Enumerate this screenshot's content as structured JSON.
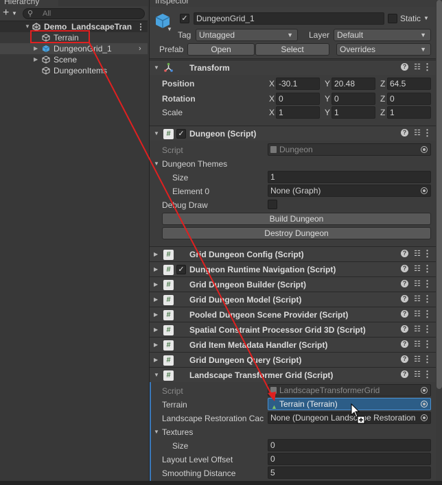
{
  "hierarchy": {
    "tab_label": "Hierarchy",
    "search_placeholder": "All",
    "scene_name": "Demo_LandscapeTran",
    "items": [
      {
        "label": "Terrain"
      },
      {
        "label": "DungeonGrid_1"
      },
      {
        "label": "Scene"
      },
      {
        "label": "DungeonItems"
      }
    ]
  },
  "inspector": {
    "tab_label": "Inspector",
    "object_name": "DungeonGrid_1",
    "static_label": "Static",
    "tag_label": "Tag",
    "tag_value": "Untagged",
    "layer_label": "Layer",
    "layer_value": "Default",
    "prefab_label": "Prefab",
    "prefab_open": "Open",
    "prefab_select": "Select",
    "prefab_overrides": "Overrides",
    "transform": {
      "title": "Transform",
      "position_label": "Position",
      "rotation_label": "Rotation",
      "scale_label": "Scale",
      "axis_x": "X",
      "axis_y": "Y",
      "axis_z": "Z",
      "position": {
        "x": "-30.1",
        "y": "20.48",
        "z": "64.5"
      },
      "rotation": {
        "x": "0",
        "y": "0",
        "z": "0"
      },
      "scale": {
        "x": "1",
        "y": "1",
        "z": "1"
      }
    },
    "dungeon_script": {
      "title": "Dungeon (Script)",
      "script_label": "Script",
      "script_value": "Dungeon",
      "themes_label": "Dungeon Themes",
      "size_label": "Size",
      "size_value": "1",
      "element_label": "Element 0",
      "element_value": "None (Graph)",
      "debug_label": "Debug Draw",
      "build_button": "Build Dungeon",
      "destroy_button": "Destroy Dungeon"
    },
    "components": [
      {
        "title": "Grid Dungeon Config (Script)"
      },
      {
        "title": "Dungeon Runtime Navigation (Script)"
      },
      {
        "title": "Grid Dungeon Builder (Script)"
      },
      {
        "title": "Grid Dungeon Model (Script)"
      },
      {
        "title": "Pooled Dungeon Scene Provider (Script)"
      },
      {
        "title": "Spatial Constraint Processor Grid 3D (Script)"
      },
      {
        "title": "Grid Item Metadata Handler (Script)"
      },
      {
        "title": "Grid Dungeon Query (Script)"
      }
    ],
    "landscape": {
      "title": "Landscape Transformer Grid (Script)",
      "script_label": "Script",
      "script_value": "LandscapeTransformerGrid",
      "terrain_label": "Terrain",
      "terrain_value": "Terrain (Terrain)",
      "restoration_label": "Landscape Restoration Cac",
      "restoration_value": "None (Dungeon Landscape Restoration",
      "textures_label": "Textures",
      "tex_size_label": "Size",
      "tex_size_value": "0",
      "layout_label": "Layout Level Offset",
      "layout_value": "0",
      "smoothing_label": "Smoothing Distance",
      "smoothing_value": "5"
    }
  },
  "colors": {
    "highlight_box": "#e02020",
    "drag_arrow": "#e02020",
    "selection_blue": "#2c5d87",
    "accent_blue": "#3a79bb"
  }
}
